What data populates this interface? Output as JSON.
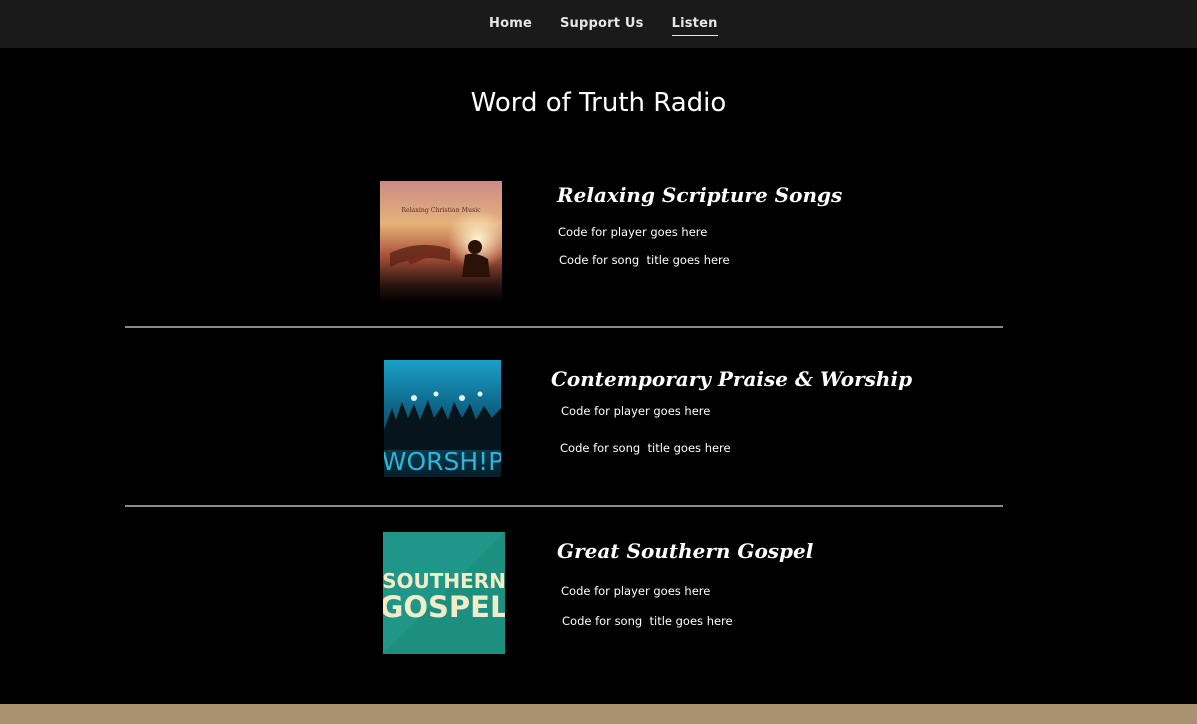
{
  "nav": {
    "items": [
      {
        "label": "Home",
        "active": false
      },
      {
        "label": "Support Us",
        "active": false
      },
      {
        "label": "Listen",
        "active": true
      }
    ]
  },
  "page": {
    "title": "Word of Truth Radio"
  },
  "stations": [
    {
      "name": "Relaxing Scripture Songs",
      "cover_text": "Relaxing Christian Music",
      "player_text": "Code for player goes here",
      "song_title_text": "Code for song  title goes here"
    },
    {
      "name": "Contemporary Praise & Worship",
      "cover_text": "WORSH!P",
      "player_text": "Code for player goes here",
      "song_title_text": "Code for song  title goes here"
    },
    {
      "name": "Great Southern Gospel",
      "cover_text_line1": "SOUTHERN",
      "cover_text_line2": "GOSPEL",
      "player_text": "Code for player goes here",
      "song_title_text": "Code for song  title goes here"
    }
  ],
  "colors": {
    "nav_background": "#1a1a1a",
    "page_background": "#000000",
    "divider": "#8a8a8a",
    "footer_band": "#a89270",
    "southern_gospel_cover": "#1f9687"
  }
}
